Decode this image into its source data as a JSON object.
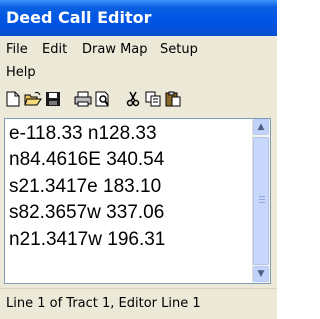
{
  "window": {
    "title": "Deed Call Editor"
  },
  "menu": {
    "file": "File",
    "edit": "Edit",
    "draw_map": "Draw Map",
    "setup": "Setup",
    "help": "Help"
  },
  "toolbar": {
    "icons": [
      "new-file-icon",
      "open-folder-icon",
      "save-icon",
      "print-icon",
      "print-preview-icon",
      "cut-icon",
      "copy-icon",
      "paste-icon"
    ]
  },
  "editor": {
    "lines": [
      "e-118.33 n128.33",
      "n84.4616E 340.54",
      "s21.3417e 183.10",
      "s82.3657w 337.06",
      "n21.3417w 196.31"
    ]
  },
  "status": {
    "text": "Line 1 of Tract 1, Editor Line 1"
  }
}
